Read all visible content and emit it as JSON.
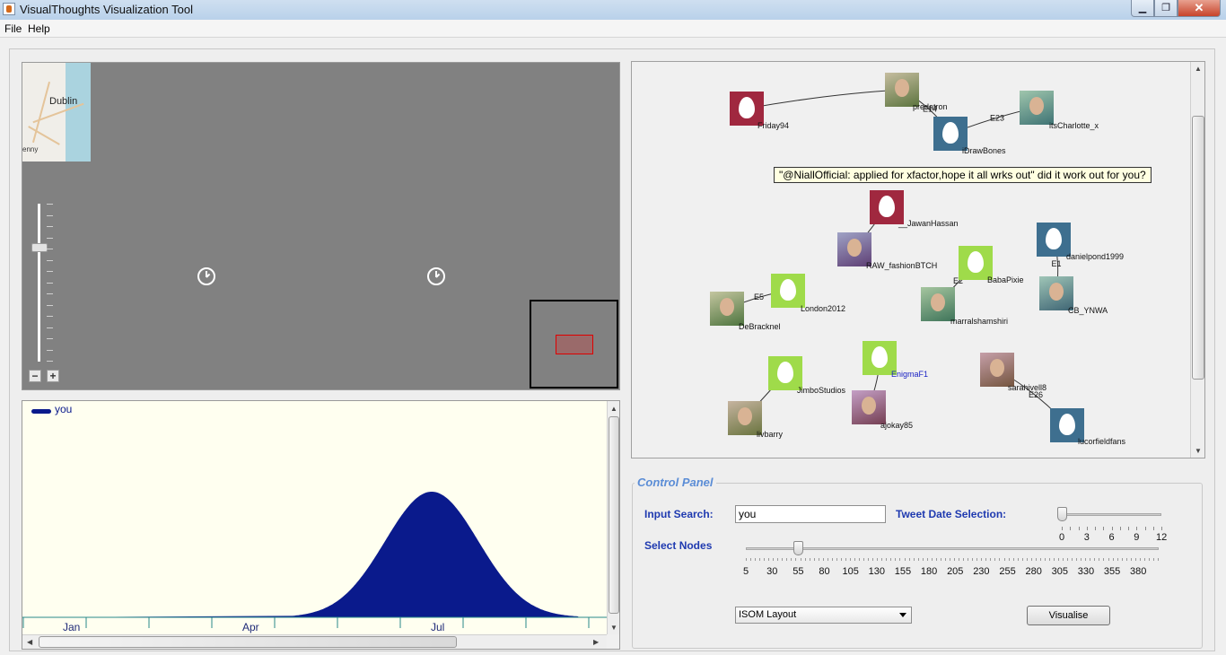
{
  "window": {
    "title": "VisualThoughts Visualization Tool",
    "minimize": "▁",
    "maximize": "❐",
    "close": "✕"
  },
  "menu": {
    "file": "File",
    "help": "Help"
  },
  "map": {
    "city": "Dublin",
    "town": "enny",
    "zoom_level": 0.75,
    "zoom_out": "−",
    "zoom_in": "+"
  },
  "timeline": {
    "legend": "you",
    "series_color": "#0a1a8c",
    "months": [
      "Jan",
      "Apr",
      "Jul"
    ]
  },
  "graph": {
    "tooltip": "\"@NiallOfficial: applied for xfactor,hope it all wrks out\" did it work out for you?",
    "colors": {
      "crimson": "#a0283f",
      "steel": "#3e6f8f",
      "lime": "#9fdb4a"
    },
    "nodes": [
      {
        "label": "Friday94",
        "kind": "egg",
        "color": "crimson"
      },
      {
        "label": "predatron",
        "kind": "avatar"
      },
      {
        "label": "iDrawBones",
        "kind": "egg",
        "color": "steel"
      },
      {
        "label": "itsCharlotte_x",
        "kind": "avatar"
      },
      {
        "label": "__JawanHassan",
        "kind": "egg",
        "color": "crimson"
      },
      {
        "label": "RAW_fashionBTCH",
        "kind": "avatar"
      },
      {
        "label": "danielpond1999",
        "kind": "egg",
        "color": "steel"
      },
      {
        "label": "BabaPixie",
        "kind": "egg",
        "color": "lime"
      },
      {
        "label": "London2012",
        "kind": "egg",
        "color": "lime"
      },
      {
        "label": "DeBracknel",
        "kind": "avatar"
      },
      {
        "label": "marralshamshiri",
        "kind": "avatar"
      },
      {
        "label": "CB_YNWA",
        "kind": "avatar"
      },
      {
        "label": "EnigmaF1",
        "kind": "egg",
        "color": "lime"
      },
      {
        "label": "JimboStudios",
        "kind": "egg",
        "color": "lime"
      },
      {
        "label": "ajokay85",
        "kind": "avatar"
      },
      {
        "label": "sarahivell8",
        "kind": "avatar"
      },
      {
        "label": "livbarry",
        "kind": "avatar"
      },
      {
        "label": "lucorfieldfans",
        "kind": "egg",
        "color": "steel"
      }
    ],
    "edges": [
      "E14",
      "E23",
      "E1",
      "E2",
      "E5",
      "E26"
    ]
  },
  "control_panel": {
    "title": "Control Panel",
    "input_search_label": "Input Search:",
    "input_search_value": "you",
    "tweet_date_label": "Tweet Date Selection:",
    "tweet_date_ticks": [
      "0",
      "3",
      "6",
      "9",
      "12"
    ],
    "tweet_date_value": 0,
    "select_nodes_label": "Select Nodes",
    "select_nodes_ticks": [
      "5",
      "30",
      "55",
      "80",
      "105",
      "130",
      "155",
      "180",
      "205",
      "230",
      "255",
      "280",
      "305",
      "330",
      "355",
      "380"
    ],
    "select_nodes_value": 55,
    "layout_value": "ISOM Layout",
    "visualise_label": "Visualise"
  }
}
